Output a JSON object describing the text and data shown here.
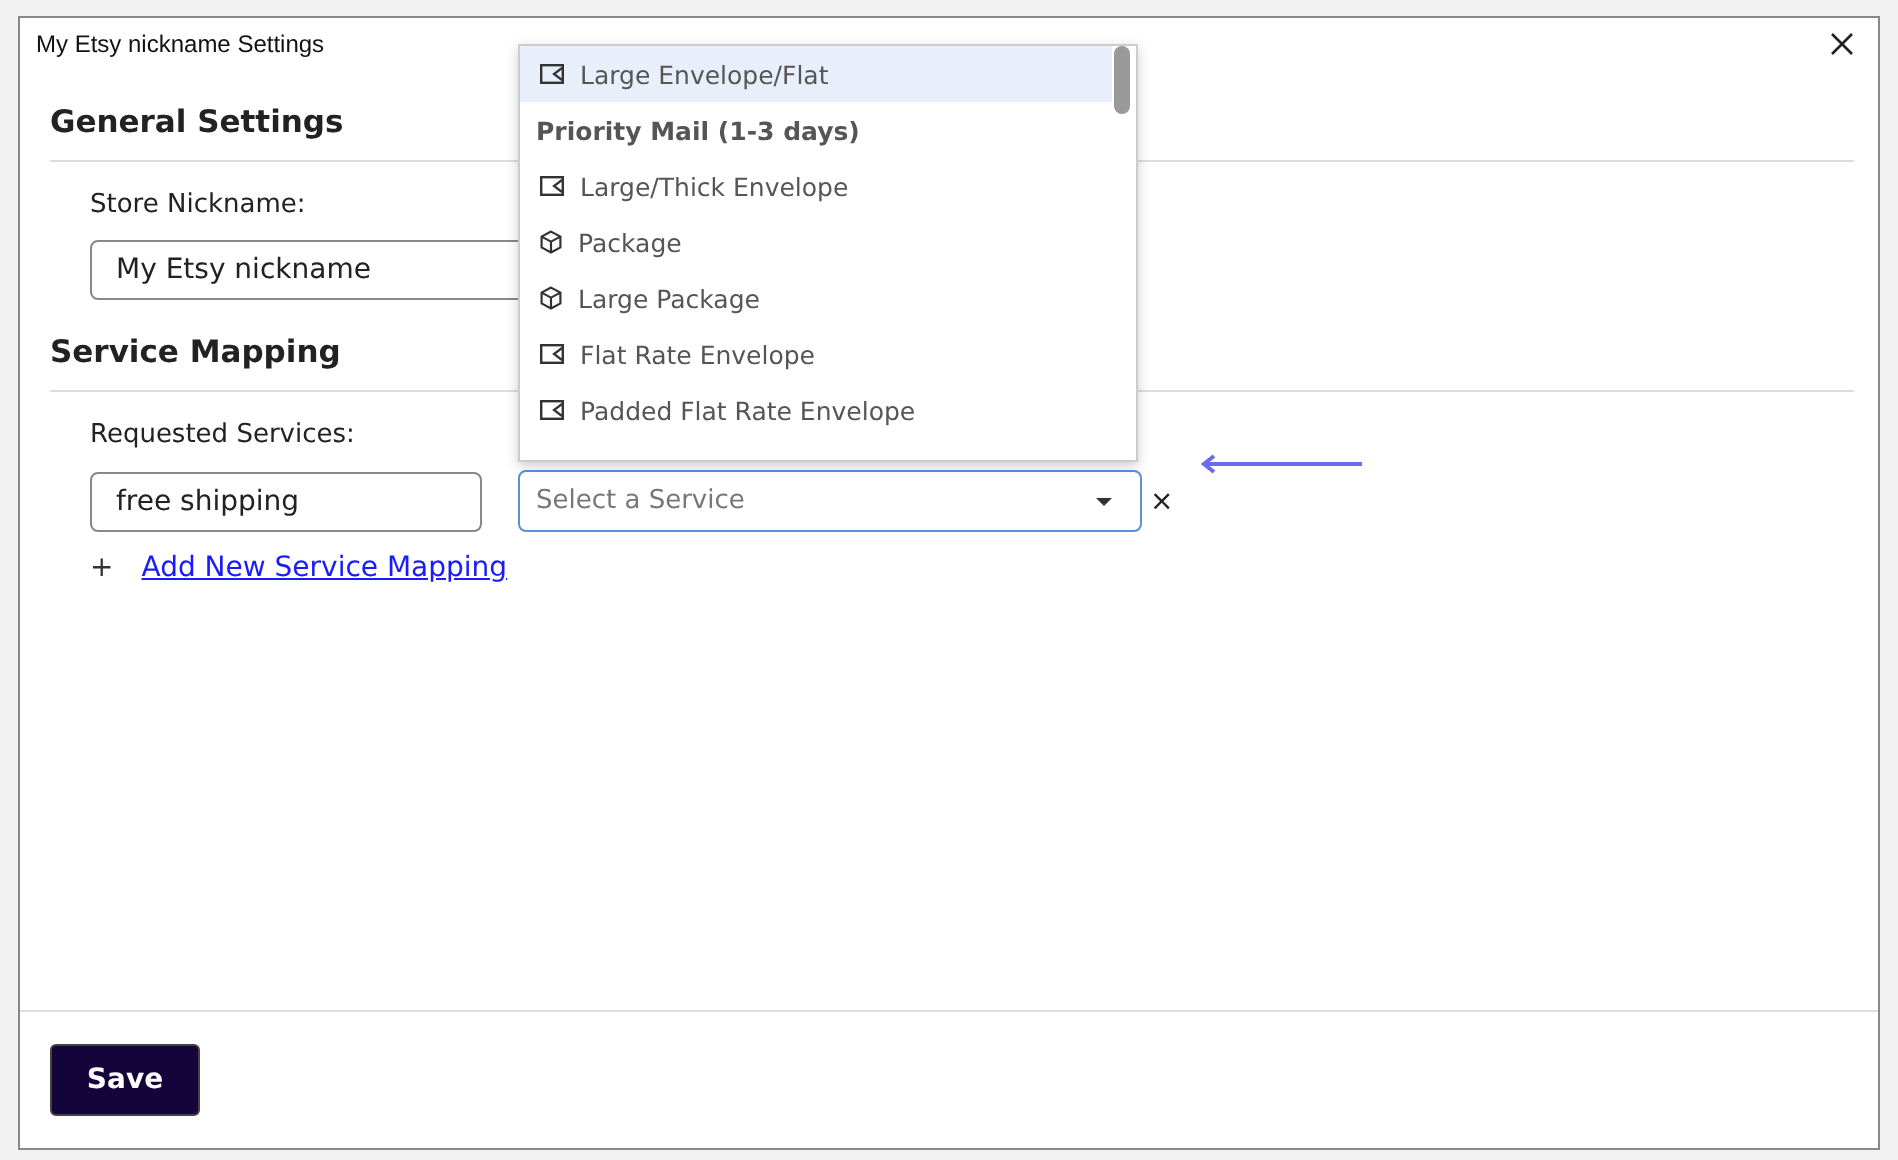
{
  "window": {
    "title": "My Etsy nickname Settings"
  },
  "general": {
    "heading": "General Settings",
    "nickname_label": "Store Nickname:",
    "nickname_value": "My Etsy nickname"
  },
  "mapping": {
    "heading": "Service Mapping",
    "requested_label": "Requested Services:",
    "requested_value": "free shipping",
    "service_placeholder": "Select a Service",
    "remove": "×",
    "add_icon": "+",
    "add_link": "Add New Service Mapping"
  },
  "dropdown": {
    "options": [
      {
        "kind": "envelope",
        "label": "Large Envelope/Flat",
        "selected": true
      },
      {
        "kind": "group",
        "label": "Priority Mail (1-3 days)",
        "selected": false
      },
      {
        "kind": "envelope",
        "label": "Large/Thick Envelope",
        "selected": false
      },
      {
        "kind": "package",
        "label": "Package",
        "selected": false
      },
      {
        "kind": "package",
        "label": "Large Package",
        "selected": false
      },
      {
        "kind": "envelope",
        "label": "Flat Rate Envelope",
        "selected": false
      },
      {
        "kind": "envelope",
        "label": "Padded Flat Rate Envelope",
        "selected": false
      }
    ]
  },
  "footer": {
    "save": "Save"
  }
}
